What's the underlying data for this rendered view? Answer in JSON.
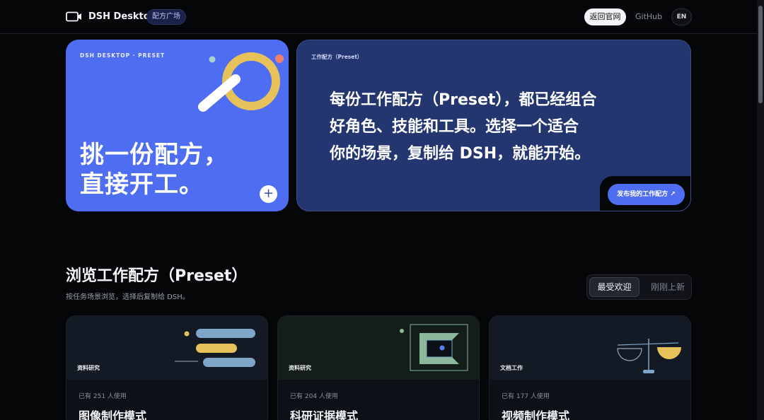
{
  "header": {
    "brand": "DSH Desktop",
    "badge": "配方广场",
    "back_label": "返回官网",
    "github_label": "GitHub",
    "lang_label": "EN"
  },
  "hero": {
    "left_eyebrow": "DSH DESKTOP · PRESET",
    "left_title_line1": "挑一份配方，",
    "left_title_line2": "直接开工。",
    "plus_label": "+",
    "right_eyebrow": "工作配方（Preset）",
    "right_line1": "每份工作配方（Preset），都已经组合",
    "right_line2": "好角色、技能和工具。选择一个适合",
    "right_line3": "你的场景，复制给 DSH，就能开始。",
    "publish_label": "发布我的工作配方 ↗"
  },
  "section": {
    "title": "浏览工作配方（Preset）",
    "subtitle": "按任务场景浏览，选择后复制给 DSH。",
    "sort_options": [
      "最受欢迎",
      "刚刚上新"
    ],
    "sort_selected": "最受欢迎"
  },
  "cards": [
    {
      "tag": "资料研究",
      "usage": "已有 251 人使用",
      "title": "图像制作模式",
      "icon": "stacked-bars-icon"
    },
    {
      "tag": "资料研究",
      "usage": "已有 204 人使用",
      "title": "科研证据模式",
      "icon": "frame-target-icon"
    },
    {
      "tag": "文档工作",
      "usage": "已有 177 人使用",
      "title": "视频制作模式",
      "icon": "balance-scale-icon"
    }
  ],
  "colors": {
    "accent": "#4f6df0",
    "hero_right_bg": "#24366f",
    "yellow": "#e7c25a",
    "coral": "#f08068",
    "steel_blue": "#7ea6c9",
    "sage": "#8db79a"
  }
}
